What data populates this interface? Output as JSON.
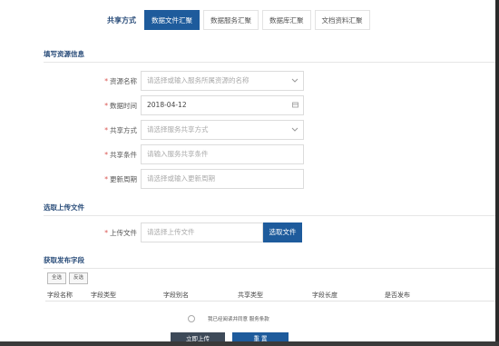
{
  "tabs": {
    "label": "共享方式",
    "items": [
      "数据文件汇聚",
      "数据服务汇聚",
      "数据库汇聚",
      "文档资料汇聚"
    ],
    "active_index": 0
  },
  "sections": {
    "fill_info": "填写资源信息",
    "upload": "选取上传文件",
    "publish_fields": "获取发布字段"
  },
  "form": {
    "resource_name": {
      "label": "资源名称",
      "placeholder": "请选择或输入服务所属资源的名称"
    },
    "data_time": {
      "label": "数据时间",
      "value": "2018-04-12"
    },
    "share_method": {
      "label": "共享方式",
      "placeholder": "请选择服务共享方式"
    },
    "share_condition": {
      "label": "共享条件",
      "placeholder": "请输入服务共享条件"
    },
    "update_cycle": {
      "label": "更新周期",
      "placeholder": "请选择或输入更新周期"
    }
  },
  "upload": {
    "label": "上传文件",
    "placeholder": "请选择上传文件",
    "button": "选取文件"
  },
  "fields_table": {
    "select_all": "全选",
    "invert": "反选",
    "columns": [
      "字段名称",
      "字段类型",
      "字段别名",
      "共享类型",
      "字段长度",
      "是否发布"
    ]
  },
  "agreement": {
    "text": "我已经阅读并同意 服务条款"
  },
  "actions": {
    "submit": "立即上传",
    "reset": "重 置"
  },
  "colors": {
    "accent": "#1e5b9c",
    "heading": "#2a4d7a",
    "required": "#d9534f"
  }
}
